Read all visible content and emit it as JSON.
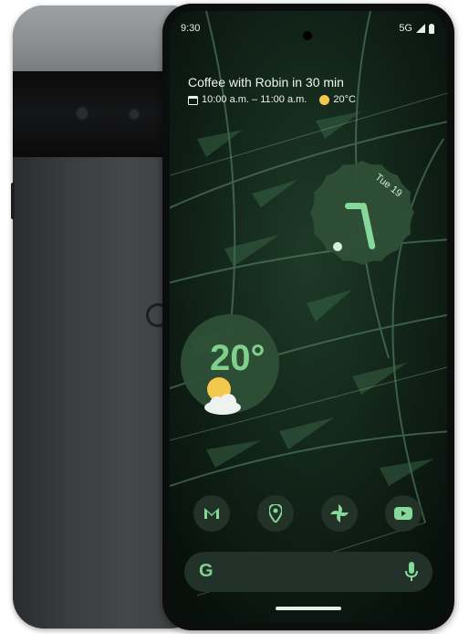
{
  "status_bar": {
    "time": "9:30",
    "network": "5G"
  },
  "at_a_glance": {
    "event_title": "Coffee with Robin in 30 min",
    "event_time": "10:00 a.m. – 11:00 a.m.",
    "temperature": "20°C"
  },
  "clock_widget": {
    "date": "Tue 19"
  },
  "weather_widget": {
    "temperature": "20°"
  },
  "dock": {
    "apps": [
      {
        "icon": "gmail-icon"
      },
      {
        "icon": "maps-pin-icon"
      },
      {
        "icon": "photos-pinwheel-icon"
      },
      {
        "icon": "youtube-icon"
      }
    ]
  },
  "search": {
    "logo": "G"
  },
  "colors": {
    "accent": "#7fd08a",
    "widget_bg": "#2e4f37",
    "screen_bg": "#0f1a14"
  }
}
